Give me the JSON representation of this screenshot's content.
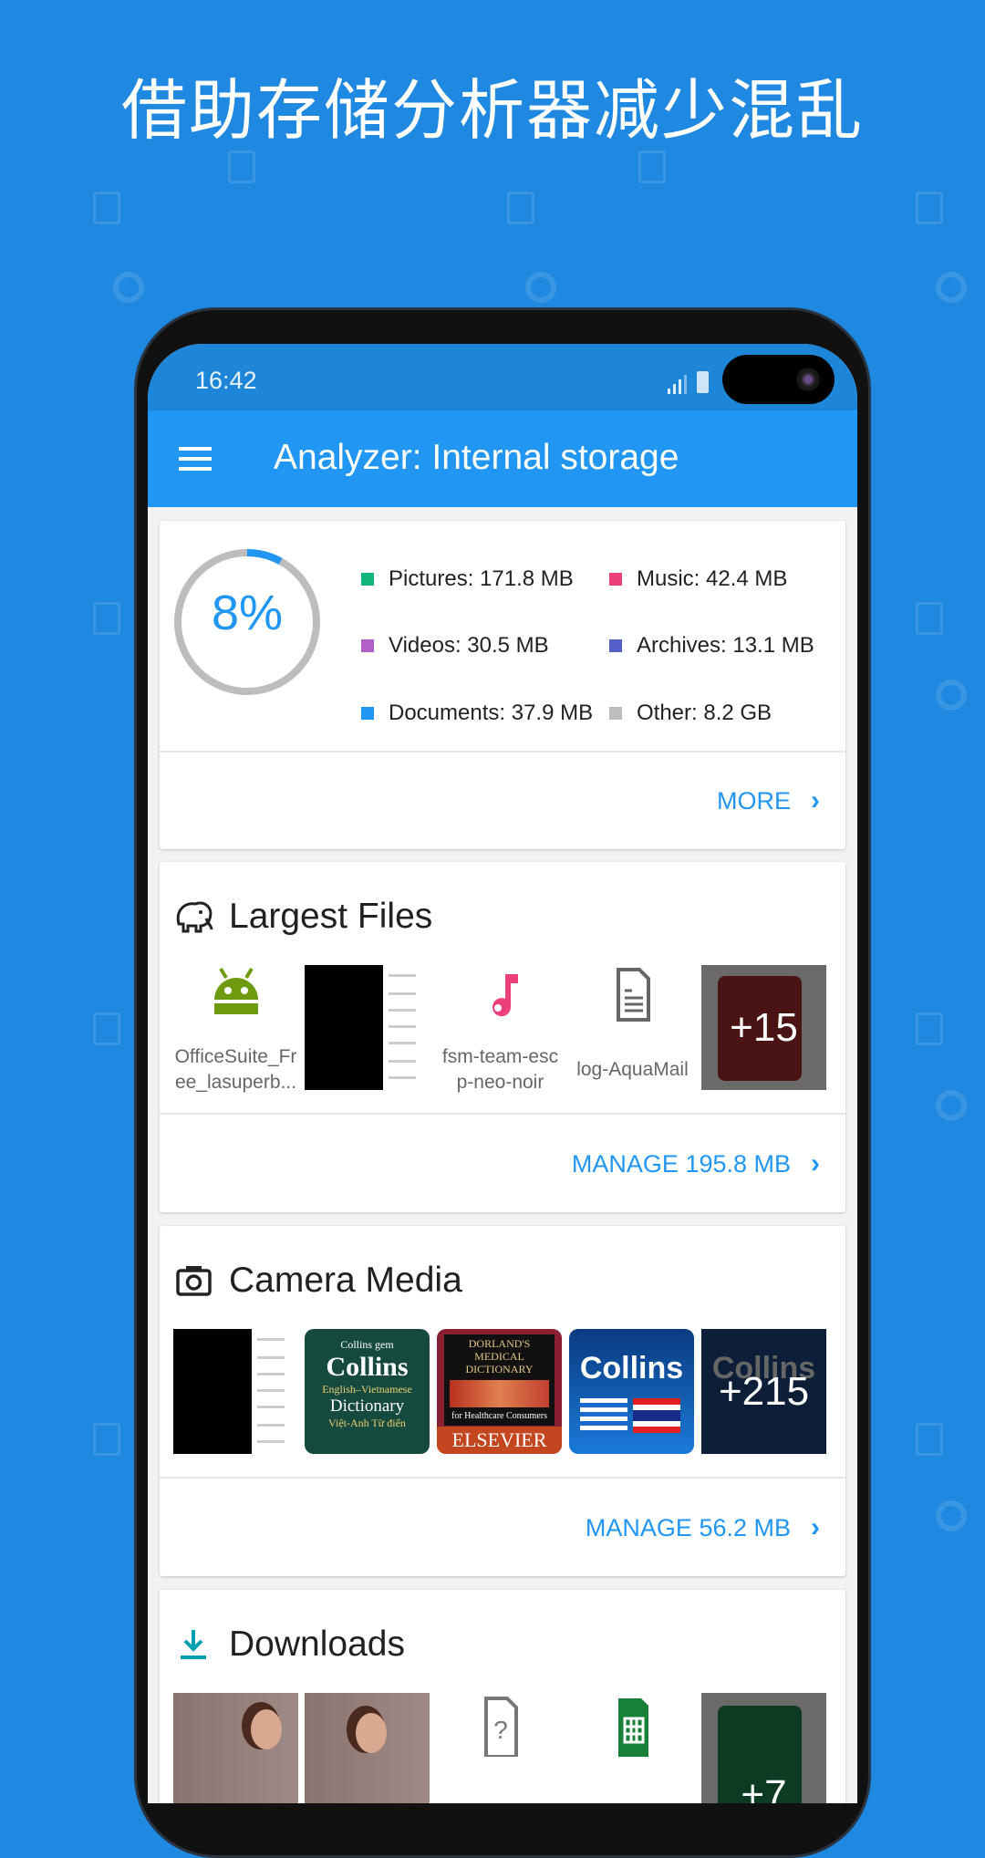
{
  "headline": "借助存储分析器减少混乱",
  "status_bar": {
    "time": "16:42"
  },
  "app_bar": {
    "title": "Analyzer: Internal storage",
    "menu_icon": "hamburger-icon"
  },
  "summary": {
    "used_percent_label": "8%",
    "used_percent": 8,
    "legend": [
      {
        "label": "Pictures: 171.8 MB",
        "color": "#12b57a"
      },
      {
        "label": "Music: 42.4 MB",
        "color": "#ec407a"
      },
      {
        "label": "Videos: 30.5 MB",
        "color": "#b15fc9"
      },
      {
        "label": "Archives: 13.1 MB",
        "color": "#5460c8"
      },
      {
        "label": "Documents: 37.9 MB",
        "color": "#2196f3"
      },
      {
        "label": "Other: 8.2 GB",
        "color": "#bdbdbd"
      }
    ],
    "more_label": "MORE"
  },
  "largest_files": {
    "title": "Largest Files",
    "icon": "elephant-icon",
    "items": [
      {
        "name": "OfficeSuite_Free_lasuperb...",
        "line1": "OfficeSuite_Fr",
        "line2": "ee_lasuperb...",
        "icon": "android-icon"
      },
      {
        "name": "",
        "type": "screenshot"
      },
      {
        "name": "fsm-team-escp-neo-noir",
        "line1": "fsm-team-esc",
        "line2": "p-neo-noir",
        "icon": "music-note-icon"
      },
      {
        "name": "log-AquaMail",
        "line1": "log-AquaMail",
        "icon": "document-icon"
      },
      {
        "more_count": "+15",
        "icon": "pdf-icon"
      }
    ],
    "manage_label": "MANAGE 195.8 MB"
  },
  "camera_media": {
    "title": "Camera Media",
    "icon": "camera-icon",
    "items": [
      {
        "type": "screenshot"
      },
      {
        "cover": "Collins gem",
        "title": "Collins",
        "sub1": "English–Vietnamese",
        "sub2": "Dictionary",
        "sub3": "Việt-Anh Từ điển"
      },
      {
        "cover": "DORLAND'S MEDICAL DICTIONARY",
        "sub": "for Healthcare Consumers",
        "publisher": "ELSEVIER"
      },
      {
        "title": "Collins"
      },
      {
        "title": "Collins",
        "more_count": "+215"
      }
    ],
    "manage_label": "MANAGE 56.2 MB"
  },
  "downloads": {
    "title": "Downloads",
    "icon": "download-icon",
    "last_more_count": "+7"
  }
}
